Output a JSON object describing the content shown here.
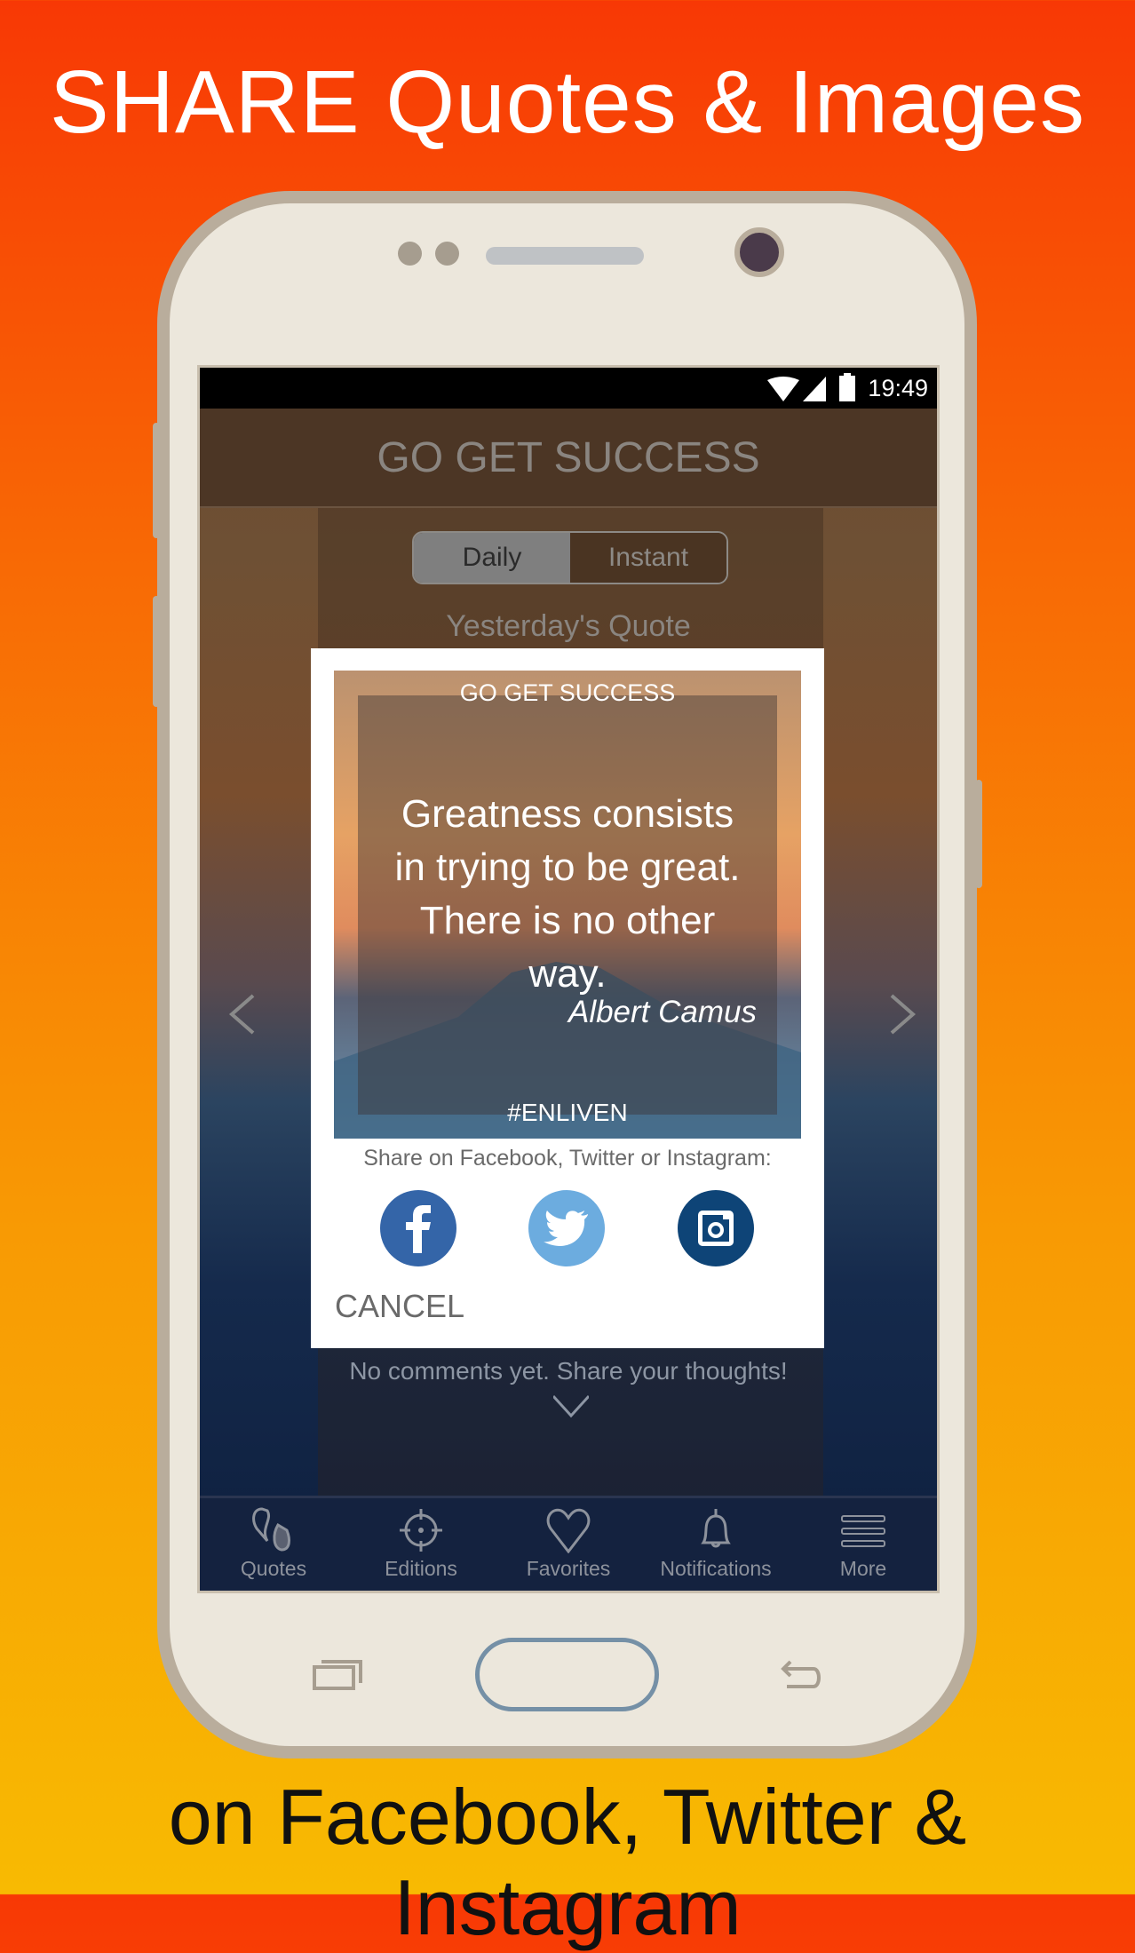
{
  "promo": {
    "headline": "SHARE Quotes & Images",
    "footer": "on Facebook, Twitter & Instagram"
  },
  "status_bar": {
    "time": "19:49",
    "icons": [
      "wifi-icon",
      "signal-icon",
      "battery-icon"
    ]
  },
  "app": {
    "title": "GO GET SUCCESS",
    "toggle": {
      "options": [
        "Daily",
        "Instant"
      ],
      "selected": "Daily"
    },
    "section_title": "Yesterday's Quote",
    "comments_text": "No comments yet. Share your thoughts!"
  },
  "share_dialog": {
    "image": {
      "brand": "GO GET SUCCESS",
      "quote_lines": [
        "Greatness consists",
        "in trying to be great.",
        "There is no other",
        "way."
      ],
      "author": "Albert Camus",
      "hashtag": "#ENLIVEN"
    },
    "prompt": "Share on Facebook, Twitter or Instagram:",
    "buttons": [
      {
        "icon": "facebook-icon",
        "color": "#3465a8"
      },
      {
        "icon": "twitter-icon",
        "color": "#6cacdf"
      },
      {
        "icon": "instagram-icon",
        "color": "#0e4477"
      }
    ],
    "cancel": "CANCEL"
  },
  "bottom_nav": [
    {
      "label": "Quotes",
      "icon": "quotes-icon"
    },
    {
      "label": "Editions",
      "icon": "crosshair-icon"
    },
    {
      "label": "Favorites",
      "icon": "heart-icon"
    },
    {
      "label": "Notifications",
      "icon": "bell-icon"
    },
    {
      "label": "More",
      "icon": "menu-icon"
    }
  ]
}
